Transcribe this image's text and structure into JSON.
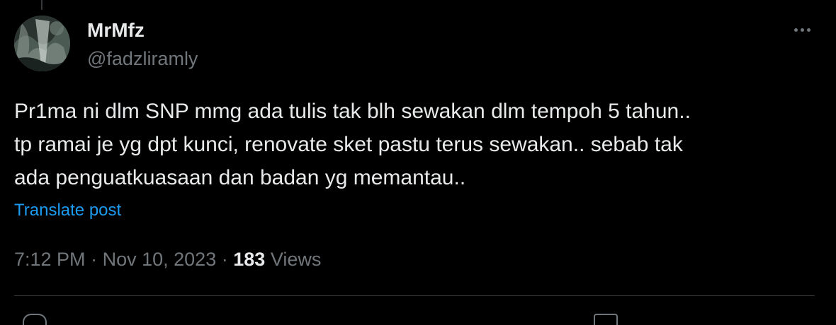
{
  "author": {
    "display_name": "MrMfz",
    "handle": "@fadzliramly"
  },
  "tweet": {
    "lines": [
      "Pr1ma ni dlm SNP mmg ada tulis tak blh sewakan dlm tempoh 5 tahun..",
      "tp ramai je yg dpt kunci, renovate sket pastu terus sewakan.. sebab tak",
      "ada penguatkuasaan dan badan yg memantau.."
    ],
    "translate_label": "Translate post"
  },
  "meta": {
    "time": "7:12 PM",
    "separator": "·",
    "date": "Nov 10, 2023",
    "views_count": "183",
    "views_label": "Views"
  },
  "icons": {
    "more": "more-horizontal-icon",
    "reply": "reply-icon",
    "bookmark": "bookmark-icon"
  },
  "colors": {
    "background": "#000000",
    "text_primary": "#e7e9ea",
    "text_secondary": "#71767b",
    "link": "#1d9bf0",
    "divider": "#2f3336"
  }
}
